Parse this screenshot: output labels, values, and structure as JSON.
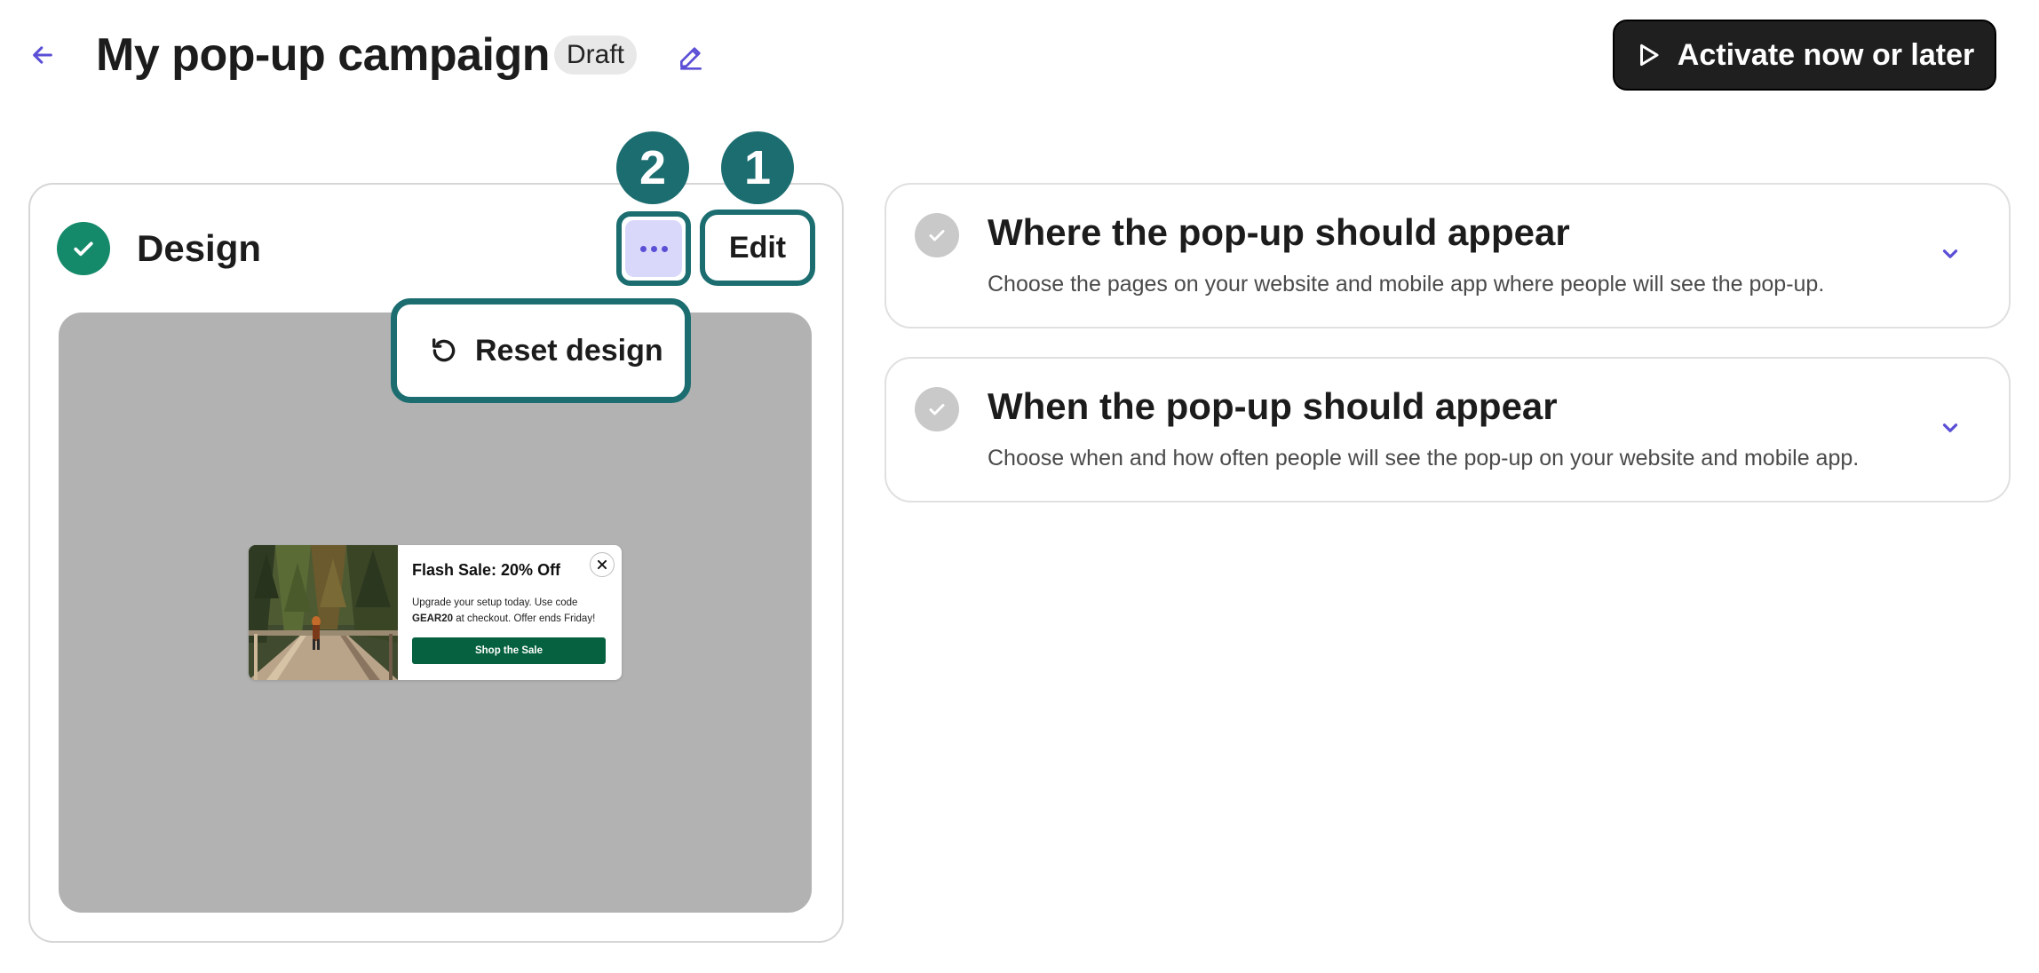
{
  "header": {
    "back_icon": "arrow-left-icon",
    "title": "My pop-up campaign",
    "status_badge": "Draft",
    "rename_icon": "pencil-icon",
    "activate_label": "Activate now or later",
    "activate_icon": "play-icon"
  },
  "design_card": {
    "status_icon": "check-icon",
    "title": "Design",
    "more_icon": "ellipsis-icon",
    "edit_label": "Edit",
    "menu": {
      "reset_icon": "undo-icon",
      "reset_label": "Reset design"
    },
    "step_markers": [
      "1",
      "2"
    ]
  },
  "popup_preview": {
    "title": "Flash Sale: 20% Off",
    "body_prefix": "Upgrade your setup today. Use code",
    "code": "GEAR20",
    "body_suffix": "at checkout. Offer ends Friday!",
    "cta_label": "Shop the Sale",
    "close_icon": "close-icon",
    "image": "forest-bridge-hiker-photo"
  },
  "sections": [
    {
      "title": "Where the pop-up should appear",
      "description": "Choose the pages on your website and mobile app where people will see the pop-up.",
      "status_icon": "check-icon",
      "chevron_icon": "chevron-down-icon"
    },
    {
      "title": "When the pop-up should appear",
      "description": "Choose when and how often people will see the pop-up on your website and mobile app.",
      "status_icon": "check-icon",
      "chevron_icon": "chevron-down-icon"
    }
  ],
  "colors": {
    "accent_purple": "#5b4fd6",
    "highlight_teal": "#1b6d70",
    "success_green": "#148a6a",
    "cta_green": "#05613f",
    "dark_button": "#1f1f1f"
  }
}
